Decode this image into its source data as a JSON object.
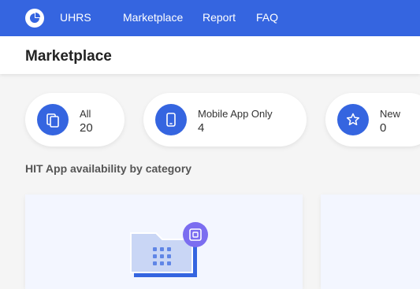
{
  "topbar": {
    "app_name": "UHRS",
    "nav": [
      "Marketplace",
      "Report",
      "FAQ"
    ]
  },
  "header": {
    "title": "Marketplace"
  },
  "filters": [
    {
      "label": "All",
      "count": "20",
      "icon": "copy-icon"
    },
    {
      "label": "Mobile App Only",
      "count": "4",
      "icon": "mobile-icon"
    },
    {
      "label": "New",
      "count": "0",
      "icon": "star-icon"
    }
  ],
  "section": {
    "title": "HIT App availability by category"
  },
  "colors": {
    "brand": "#3565e0",
    "badge": "#7b6df0"
  }
}
